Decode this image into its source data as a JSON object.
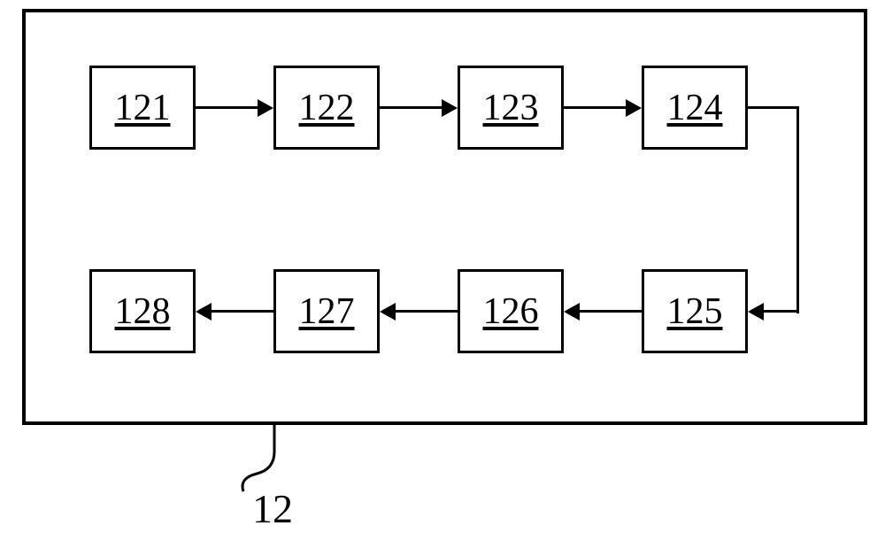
{
  "diagram": {
    "reference_number": "12",
    "blocks": [
      {
        "id": "b121",
        "label": "121"
      },
      {
        "id": "b122",
        "label": "122"
      },
      {
        "id": "b123",
        "label": "123"
      },
      {
        "id": "b124",
        "label": "124"
      },
      {
        "id": "b125",
        "label": "125"
      },
      {
        "id": "b126",
        "label": "126"
      },
      {
        "id": "b127",
        "label": "127"
      },
      {
        "id": "b128",
        "label": "128"
      }
    ],
    "flow_sequence": [
      "121",
      "122",
      "123",
      "124",
      "125",
      "126",
      "127",
      "128"
    ]
  }
}
